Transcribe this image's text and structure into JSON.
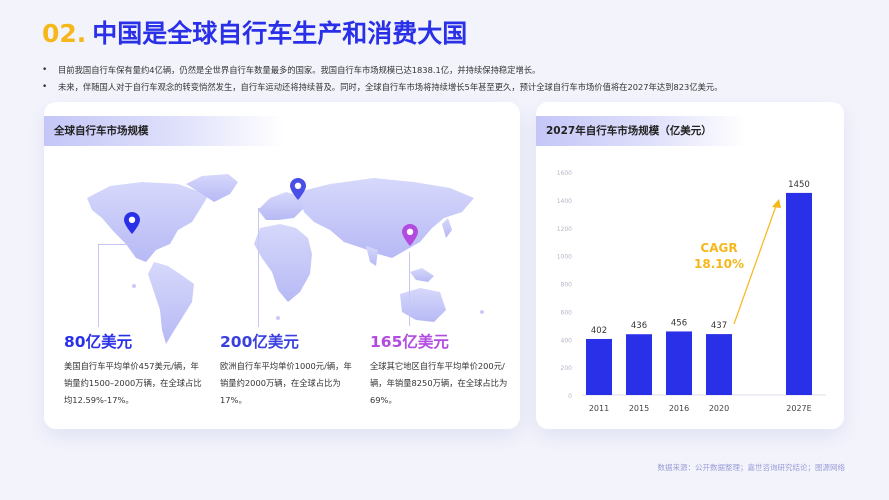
{
  "header": {
    "number": "02.",
    "title": "中国是全球自行车生产和消费大国"
  },
  "bullets": [
    "目前我国自行车保有量约4亿辆，仍然是全世界自行车数量最多的国家。我国自行车市场规模已达1838.1亿，并持续保持稳定增长。",
    "未来，伴随国人对于自行车观念的转变悄然发生，自行车运动还将持续普及。同时，全球自行车市场将持续增长5年甚至更久，预计全球自行车市场价值将在2027年达到823亿美元。"
  ],
  "left_card": {
    "title": "全球自行车市场规模",
    "stats": [
      {
        "value": "80亿美元",
        "desc": "美国自行车平均单价457美元/辆，年销量约1500–2000万辆，在全球占比均12.59%-17%。",
        "color": "#2a2fe8"
      },
      {
        "value": "200亿美元",
        "desc": "欧洲自行车平均单价1000元/辆，年销量约2000万辆，在全球占比为17%。",
        "color": "#3a3fe0"
      },
      {
        "value": "165亿美元",
        "desc": "全球其它地区自行车平均单价200元/辆，年销量8250万辆，在全球占比为69%。",
        "color": "#b24be0"
      }
    ]
  },
  "right_card": {
    "title": "2027年自行车市场规模（亿美元）"
  },
  "chart_data": {
    "type": "bar",
    "categories": [
      "2011",
      "2015",
      "2016",
      "2020",
      "2027E"
    ],
    "values": [
      402,
      436,
      456,
      437,
      1450
    ],
    "ylim": [
      0,
      1600
    ],
    "yticks": [
      "0",
      "200",
      "400",
      "600",
      "800",
      "1000",
      "1200",
      "1400",
      "1600"
    ],
    "bar_color": "#2a2fe8",
    "annotation": {
      "label": "CAGR",
      "value": "18.10%",
      "color": "#f5b71a"
    }
  },
  "source": "数据来源：公开数据整理；嘉世咨询研究结论；图源网络"
}
